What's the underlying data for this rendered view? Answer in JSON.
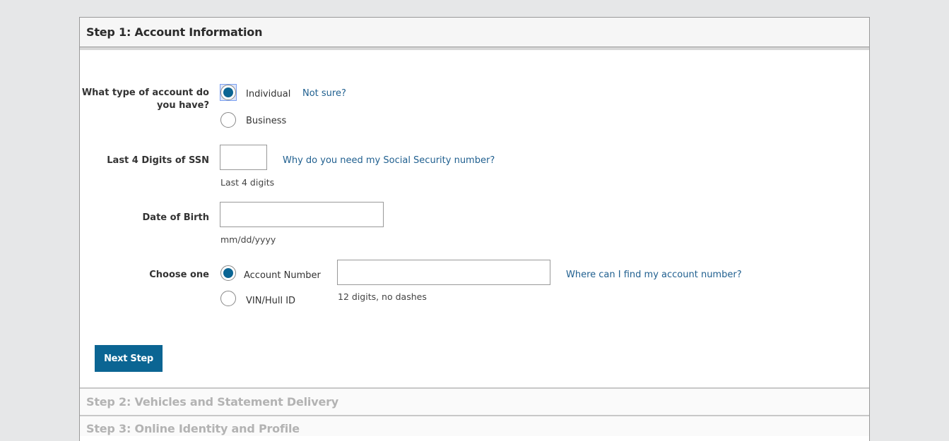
{
  "steps": [
    {
      "title": "Step 1: Account Information",
      "state": "expanded"
    },
    {
      "title": "Step 2: Vehicles and Statement Delivery",
      "state": "collapsed"
    },
    {
      "title": "Step 3: Online Identity and Profile",
      "state": "collapsed"
    }
  ],
  "form": {
    "account_type": {
      "label": "What type of account do you have?",
      "label_line1": "What type of account do",
      "label_line2": "you have?",
      "options": [
        {
          "label": "Individual",
          "checked": true
        },
        {
          "label": "Business",
          "checked": false
        }
      ],
      "help_link": "Not sure?"
    },
    "ssn": {
      "label": "Last 4 Digits of SSN",
      "value": "",
      "hint": "Last 4 digits",
      "help_link": "Why do you need my Social Security number?"
    },
    "dob": {
      "label": "Date of Birth",
      "value": "",
      "hint": "mm/dd/yyyy"
    },
    "identifier": {
      "label": "Choose one",
      "options": [
        {
          "label": "Account Number",
          "checked": true
        },
        {
          "label": "VIN/Hull ID",
          "checked": false
        }
      ],
      "value": "",
      "hint": "12 digits, no dashes",
      "help_link": "Where can I find my account number?"
    },
    "next_button": "Next Step"
  },
  "colors": {
    "accent": "#0b6593",
    "link": "#1f5f8f",
    "page_bg": "#e6e7e8"
  }
}
